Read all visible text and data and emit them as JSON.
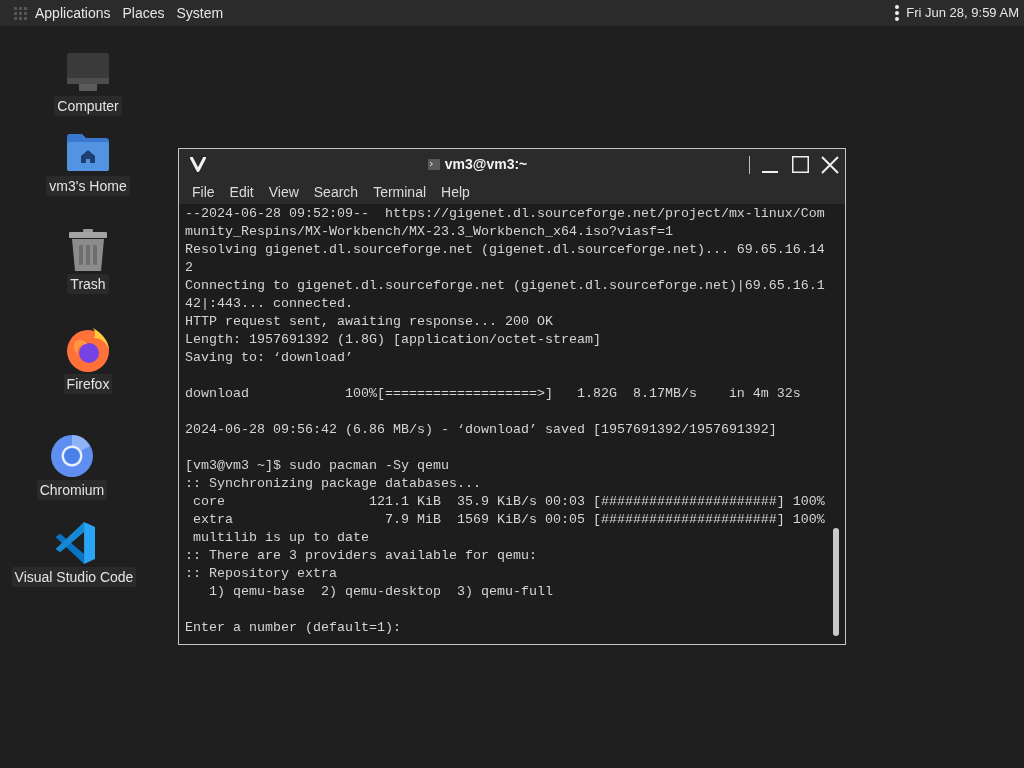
{
  "top_panel": {
    "menus": [
      "Applications",
      "Places",
      "System"
    ],
    "clock": "Fri Jun 28, 9:59 AM"
  },
  "desktop_icons": [
    {
      "label": "Computer",
      "kind": "computer"
    },
    {
      "label": "vm3's Home",
      "kind": "home"
    },
    {
      "label": "Trash",
      "kind": "trash"
    },
    {
      "label": "Firefox",
      "kind": "firefox"
    },
    {
      "label": "Chromium",
      "kind": "chromium"
    },
    {
      "label": "Visual Studio Code",
      "kind": "vscode"
    }
  ],
  "terminal_window": {
    "title": "vm3@vm3:~",
    "menu": [
      "File",
      "Edit",
      "View",
      "Search",
      "Terminal",
      "Help"
    ],
    "output_blocks": [
      [
        "--2024-06-28 09:52:09--  https://gigenet.dl.sourceforge.net/project/mx-linux/Com",
        "munity_Respins/MX-Workbench/MX-23.3_Workbench_x64.iso?viasf=1",
        "Resolving gigenet.dl.sourceforge.net (gigenet.dl.sourceforge.net)... 69.65.16.14",
        "2",
        "Connecting to gigenet.dl.sourceforge.net (gigenet.dl.sourceforge.net)|69.65.16.1",
        "42|:443... connected.",
        "HTTP request sent, awaiting response... 200 OK",
        "Length: 1957691392 (1.8G) [application/octet-stream]",
        "Saving to: ‘download’"
      ],
      [
        "download            100%[===================>]   1.82G  8.17MB/s    in 4m 32s"
      ],
      [
        "2024-06-28 09:56:42 (6.86 MB/s) - ‘download’ saved [1957691392/1957691392]"
      ],
      [
        "[vm3@vm3 ~]$ sudo pacman -Sy qemu",
        ":: Synchronizing package databases...",
        " core                  121.1 KiB  35.9 KiB/s 00:03 [######################] 100%",
        " extra                   7.9 MiB  1569 KiB/s 00:05 [######################] 100%",
        " multilib is up to date",
        ":: There are 3 providers available for qemu:",
        ":: Repository extra",
        "   1) qemu-base  2) qemu-desktop  3) qemu-full"
      ],
      [
        "Enter a number (default=1):"
      ]
    ]
  }
}
